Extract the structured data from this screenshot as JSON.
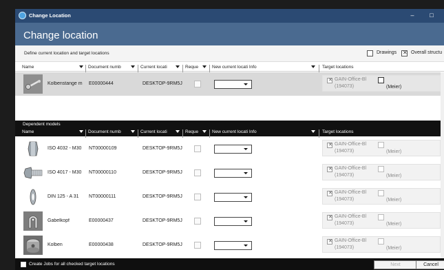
{
  "window": {
    "title": "Change Location",
    "header_title": "Change location"
  },
  "subbar": {
    "define_label": "Define current location and target locations",
    "drawings_label": "Drawings",
    "drawings_checked": false,
    "overall_label": "Overall structu",
    "overall_checked": true
  },
  "columns": {
    "name": "Name",
    "docno": "Document numb",
    "current": "Current locati",
    "request": "Reque",
    "new_current": "New current locati Info",
    "target": "Target locations"
  },
  "top_rows": [
    {
      "name": "Kolbenstange m",
      "docno": "E00000444",
      "location": "DESKTOP-9RM5J",
      "target_name": "GAIN-Office-Bl",
      "target_id": "(194073)",
      "owner": "(Meier)"
    }
  ],
  "dependent": {
    "title": "Dependent models",
    "rows": [
      {
        "name": "ISO 4032 - M30",
        "docno": "NT00000109",
        "location": "DESKTOP-9RM5J",
        "target_name": "GAIN-Office-Bl",
        "target_id": "(194073)",
        "owner": "(Meier)",
        "thumb_icon": "hex-nut-icon"
      },
      {
        "name": "ISO 4017 - M30",
        "docno": "NT00000110",
        "location": "DESKTOP-9RM5J",
        "target_name": "GAIN-Office-Bl",
        "target_id": "(194073)",
        "owner": "(Meier)",
        "thumb_icon": "hex-bolt-icon"
      },
      {
        "name": "DIN 125 - A 31",
        "docno": "NT00000111",
        "location": "DESKTOP-9RM5J",
        "target_name": "GAIN-Office-Bl",
        "target_id": "(194073)",
        "owner": "(Meier)",
        "thumb_icon": "washer-icon"
      },
      {
        "name": "Gabelkopf",
        "docno": "E00000437",
        "location": "DESKTOP-9RM5J",
        "target_name": "GAIN-Office-Bl",
        "target_id": "(194073)",
        "owner": "(Meier)",
        "thumb_icon": "clevis-icon"
      },
      {
        "name": "Kolben",
        "docno": "E00000438",
        "location": "DESKTOP-9RM5J",
        "target_name": "GAIN-Office-Bl",
        "target_id": "(194073)",
        "owner": "(Meier)",
        "thumb_icon": "piston-icon"
      }
    ]
  },
  "footer": {
    "create_jobs_label": "Create Jobs for all checked target locations",
    "next_label": "Next",
    "cancel_label": "Cancel"
  },
  "colors": {
    "titlebar": "#2b4a73",
    "header": "#4a6a90",
    "section_bar": "#111111",
    "selected_row": "#d9d9d9"
  }
}
